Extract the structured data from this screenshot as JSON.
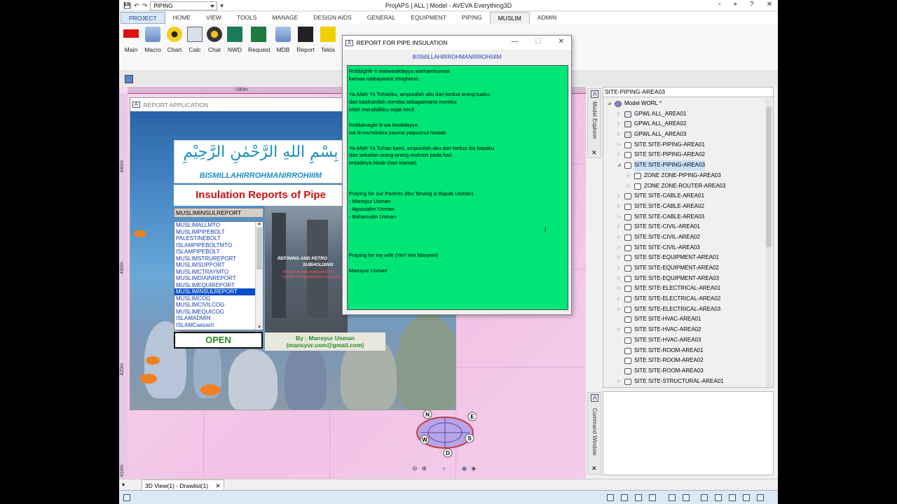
{
  "window": {
    "title": "ProjAPS | ALL | Model - AVEVA Everything3D",
    "quick_combo": "PIPING",
    "controls": [
      "▫",
      "⌖",
      "?",
      "✕"
    ]
  },
  "tabs": [
    "PROJECT",
    "HOME",
    "VIEW",
    "TOOLS",
    "MANAGE",
    "DESIGN AIDS",
    "GENERAL",
    "EQUIPMENT",
    "PIPING",
    "MUSLIM",
    "ADMIN"
  ],
  "ribbon": [
    "Main",
    "Macro",
    "Chart",
    "Calc",
    "Chat",
    "NWD",
    "Request",
    "MDB",
    "Report",
    "Tekla"
  ],
  "ruler": {
    "top": "-180m",
    "left": [
      "440m",
      "430m",
      "420m",
      "410m"
    ]
  },
  "report_app": {
    "title": "REPORT APPLICATION",
    "arabic": "بِسْمِ اللهِ الرَّحْمٰنِ الرَّحِيْمِ",
    "bismillah": "BISMILLAHIRROHMANIRROHIIIM",
    "heading": "Insulation Reports of Pipe",
    "combo_value": "MUSLIMINSULREPORT",
    "list": [
      "MUSLIMALLMTO",
      "MUSLIMPIPEBOLT",
      "PALESTINEBOLT",
      "ISLAMPIPEBOLTMTO",
      "ISLAMPIPEBOLT",
      "MUSLIMSTRUREPORT",
      "MUSLIMSUPPORT",
      "MUSLIMCTRAYMTO",
      "MUSLIMDIAINREPORT",
      "MUSLIMEQUIREPORT",
      "MUSLIMINSULREPORT",
      "MUSLIMCOG",
      "MUSLIMCIVILCOG",
      "MUSLIMEQUICOG",
      "ISLAMADMIN",
      "ISLAMCaesarII"
    ],
    "selected": "MUSLIMINSULREPORT",
    "open_label": "OPEN",
    "by_line1": "By : Mansyur Usman",
    "by_line2": "(mansyur.usm@gmail.com)",
    "photo_caption": "REFINING AND PETRO",
    "photo_caption2": "SUBHOLDING",
    "photo_red": "Masak minyak menta produk-produk energ dinikmati masyarakat"
  },
  "dialog": {
    "title": "REPORT FOR PIPE INSULATION",
    "heading": "BISMILLAHIRROHMANIRROHIIIIM",
    "text": "Robbighfir-li waliwaalidayya warhamhumaa\nkamaa robbayaanii shoghiroo.\n\nYa Allah Ya Tuhanku, ampunilah aku dan kedua orang tuaku,\ndan kasihanilah mereka sebagaimana mereka\ntelah mendidikku sejak kecil.\n\nRobbanagfir lii wa liwalidayya\nwa lil-mu'miniina yauma yaquumul hisaab\n\nYa Allah Ya Tuhan kami, ampunilah aku dan kedua ibu bapaku\ndan sekalian orang-orang mukmin pada hari\nterjadinya hisab (hari kiamat)\n\n\n\nPraying for our Parents (Ibu Tenang & Bapak Usman)\n- Mansyur Usman\n- Agussalim Usman\n- Baharrudin Usman\n\n\n\n\nPraying for my wife (Yeri Yen Maryeni)\n\nMansyur Usman"
  },
  "explorer": {
    "label": "Model Explorer",
    "combo": "SITE-PIPING-AREA03",
    "items": [
      {
        "label": "Model WORL *",
        "indent": 0,
        "arrow": "◢",
        "kind": "world"
      },
      {
        "label": "GPWL ALL_AREA01",
        "indent": 1,
        "arrow": "▷",
        "kind": "gpwl"
      },
      {
        "label": "GPWL ALL_AREA02",
        "indent": 1,
        "arrow": "▷",
        "kind": "gpwl"
      },
      {
        "label": "GPWL ALL_AREA03",
        "indent": 1,
        "arrow": "▷",
        "kind": "gpwl"
      },
      {
        "label": "SITE SITE-PIPING-AREA01",
        "indent": 1,
        "arrow": "▷",
        "kind": "site"
      },
      {
        "label": "SITE SITE-PIPING-AREA02",
        "indent": 1,
        "arrow": "▷",
        "kind": "site"
      },
      {
        "label": "SITE SITE-PIPING-AREA03",
        "indent": 1,
        "arrow": "◢",
        "kind": "site",
        "selected": true
      },
      {
        "label": "ZONE ZONE-PIPING-AREA03",
        "indent": 2,
        "arrow": "▷",
        "kind": "zone"
      },
      {
        "label": "ZONE ZONE-ROUTER-AREA03",
        "indent": 2,
        "arrow": "▷",
        "kind": "zone"
      },
      {
        "label": "SITE SITE-CABLE-AREA01",
        "indent": 1,
        "arrow": "▷",
        "kind": "site"
      },
      {
        "label": "SITE SITE-CABLE-AREA02",
        "indent": 1,
        "arrow": "▷",
        "kind": "site"
      },
      {
        "label": "SITE SITE-CABLE-AREA03",
        "indent": 1,
        "arrow": "▷",
        "kind": "site"
      },
      {
        "label": "SITE SITE-CIVIL-AREA01",
        "indent": 1,
        "arrow": "▷",
        "kind": "site"
      },
      {
        "label": "SITE SITE-CIVIL-AREA02",
        "indent": 1,
        "arrow": "▷",
        "kind": "site"
      },
      {
        "label": "SITE SITE-CIVIL-AREA03",
        "indent": 1,
        "arrow": "▷",
        "kind": "site"
      },
      {
        "label": "SITE SITE-EQUIPMENT-AREA01",
        "indent": 1,
        "arrow": "▷",
        "kind": "site"
      },
      {
        "label": "SITE SITE-EQUIPMENT-AREA02",
        "indent": 1,
        "arrow": "▷",
        "kind": "site"
      },
      {
        "label": "SITE SITE-EQUIPMENT-AREA03",
        "indent": 1,
        "arrow": "▷",
        "kind": "site"
      },
      {
        "label": "SITE SITE-ELECTRICAL-AREA01",
        "indent": 1,
        "arrow": "▷",
        "kind": "site"
      },
      {
        "label": "SITE SITE-ELECTRICAL-AREA02",
        "indent": 1,
        "arrow": "▷",
        "kind": "site"
      },
      {
        "label": "SITE SITE-ELECTRICAL-AREA03",
        "indent": 1,
        "arrow": "▷",
        "kind": "site"
      },
      {
        "label": "SITE SITE-HVAC-AREA01",
        "indent": 1,
        "arrow": "",
        "kind": "site"
      },
      {
        "label": "SITE SITE-HVAC-AREA02",
        "indent": 1,
        "arrow": "▷",
        "kind": "site"
      },
      {
        "label": "SITE SITE-HVAC-AREA03",
        "indent": 1,
        "arrow": "",
        "kind": "site"
      },
      {
        "label": "SITE SITE-ROOM-AREA01",
        "indent": 1,
        "arrow": "",
        "kind": "site"
      },
      {
        "label": "SITE SITE-ROOM-AREA02",
        "indent": 1,
        "arrow": "",
        "kind": "site"
      },
      {
        "label": "SITE SITE-ROOM-AREA03",
        "indent": 1,
        "arrow": "",
        "kind": "site"
      },
      {
        "label": "SITE SITE-STRUCTURAL-AREA01",
        "indent": 1,
        "arrow": "▷",
        "kind": "site"
      }
    ]
  },
  "command_window": {
    "label": "Command Window"
  },
  "compass": {
    "n": "N",
    "e": "E",
    "s": "S",
    "w": "W",
    "d": "D"
  },
  "doc_tab": {
    "label": "3D View(1) - Drawlist(1)",
    "close": "✕"
  },
  "colors": {
    "dialog_bg": "#00e676",
    "viewport": "#f2c2e6",
    "selection": "#0a4fc8"
  }
}
